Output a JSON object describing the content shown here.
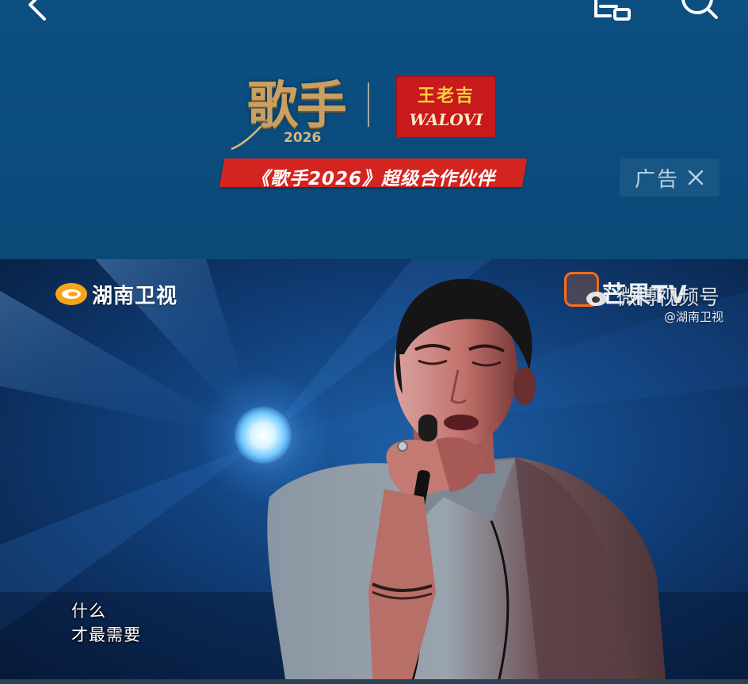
{
  "header": {
    "back_icon": "chevron-left-icon",
    "cast_icon": "cast-screen-icon",
    "search_icon": "search-icon"
  },
  "ad": {
    "show_logo_main": "歌手",
    "show_logo_year": "2026",
    "sponsor_name": "王老吉",
    "sponsor_name_latin": "WALOVI",
    "partner_banner": "《歌手2026》超级合作伙伴",
    "ad_label": "广告",
    "close_icon": "close-icon",
    "colors": {
      "banner_red": "#d4241f",
      "sponsor_red": "#c8191c",
      "gold": "#c9a061",
      "background": "#0b4a78"
    }
  },
  "video": {
    "channel_name": "湖南卫视",
    "platform_name": "芒果TV",
    "weibo_label": "微博视频号",
    "weibo_handle": "@湖南卫视",
    "subtitle_line_1": "什么",
    "subtitle_line_2": "才最需要"
  }
}
